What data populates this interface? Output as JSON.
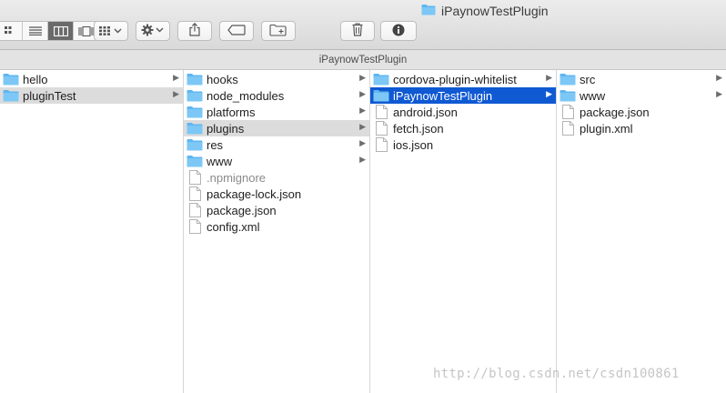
{
  "window": {
    "title": "iPaynowTestPlugin"
  },
  "pathbar": {
    "text": "iPaynowTestPlugin"
  },
  "icons": {
    "view_icons": "icon-view-icon",
    "view_list": "list-view-icon",
    "view_columns": "column-view-icon",
    "view_gallery": "gallery-view-icon",
    "group": "group-icon",
    "action": "gear-icon",
    "share": "share-icon",
    "tags": "tag-icon",
    "new_folder": "new-folder-icon",
    "trash": "trash-icon",
    "info": "info-icon"
  },
  "colors": {
    "folder": "#5fb6f0",
    "selection": "#0f59d3",
    "selection_inactive": "#dcdcdc"
  },
  "columns": [
    {
      "items": [
        {
          "name": "hello",
          "type": "folder",
          "arrow": true,
          "state": ""
        },
        {
          "name": "pluginTest",
          "type": "folder",
          "arrow": true,
          "state": "gray"
        }
      ]
    },
    {
      "items": [
        {
          "name": "hooks",
          "type": "folder",
          "arrow": true,
          "state": ""
        },
        {
          "name": "node_modules",
          "type": "folder",
          "arrow": true,
          "state": ""
        },
        {
          "name": "platforms",
          "type": "folder",
          "arrow": true,
          "state": ""
        },
        {
          "name": "plugins",
          "type": "folder",
          "arrow": true,
          "state": "gray"
        },
        {
          "name": "res",
          "type": "folder",
          "arrow": true,
          "state": ""
        },
        {
          "name": "www",
          "type": "folder",
          "arrow": true,
          "state": ""
        },
        {
          "name": ".npmignore",
          "type": "file",
          "arrow": false,
          "state": "",
          "dim": true
        },
        {
          "name": "package-lock.json",
          "type": "file",
          "arrow": false,
          "state": ""
        },
        {
          "name": "package.json",
          "type": "file",
          "arrow": false,
          "state": ""
        },
        {
          "name": "config.xml",
          "type": "file",
          "arrow": false,
          "state": ""
        }
      ]
    },
    {
      "items": [
        {
          "name": "cordova-plugin-whitelist",
          "type": "folder",
          "arrow": true,
          "state": ""
        },
        {
          "name": "iPaynowTestPlugin",
          "type": "folder",
          "arrow": true,
          "state": "blue"
        },
        {
          "name": "android.json",
          "type": "file",
          "arrow": false,
          "state": ""
        },
        {
          "name": "fetch.json",
          "type": "file",
          "arrow": false,
          "state": ""
        },
        {
          "name": "ios.json",
          "type": "file",
          "arrow": false,
          "state": ""
        }
      ]
    },
    {
      "items": [
        {
          "name": "src",
          "type": "folder",
          "arrow": true,
          "state": ""
        },
        {
          "name": "www",
          "type": "folder",
          "arrow": true,
          "state": ""
        },
        {
          "name": "package.json",
          "type": "file",
          "arrow": false,
          "state": ""
        },
        {
          "name": "plugin.xml",
          "type": "file",
          "arrow": false,
          "state": ""
        }
      ]
    }
  ],
  "watermark": "http://blog.csdn.net/csdn100861"
}
